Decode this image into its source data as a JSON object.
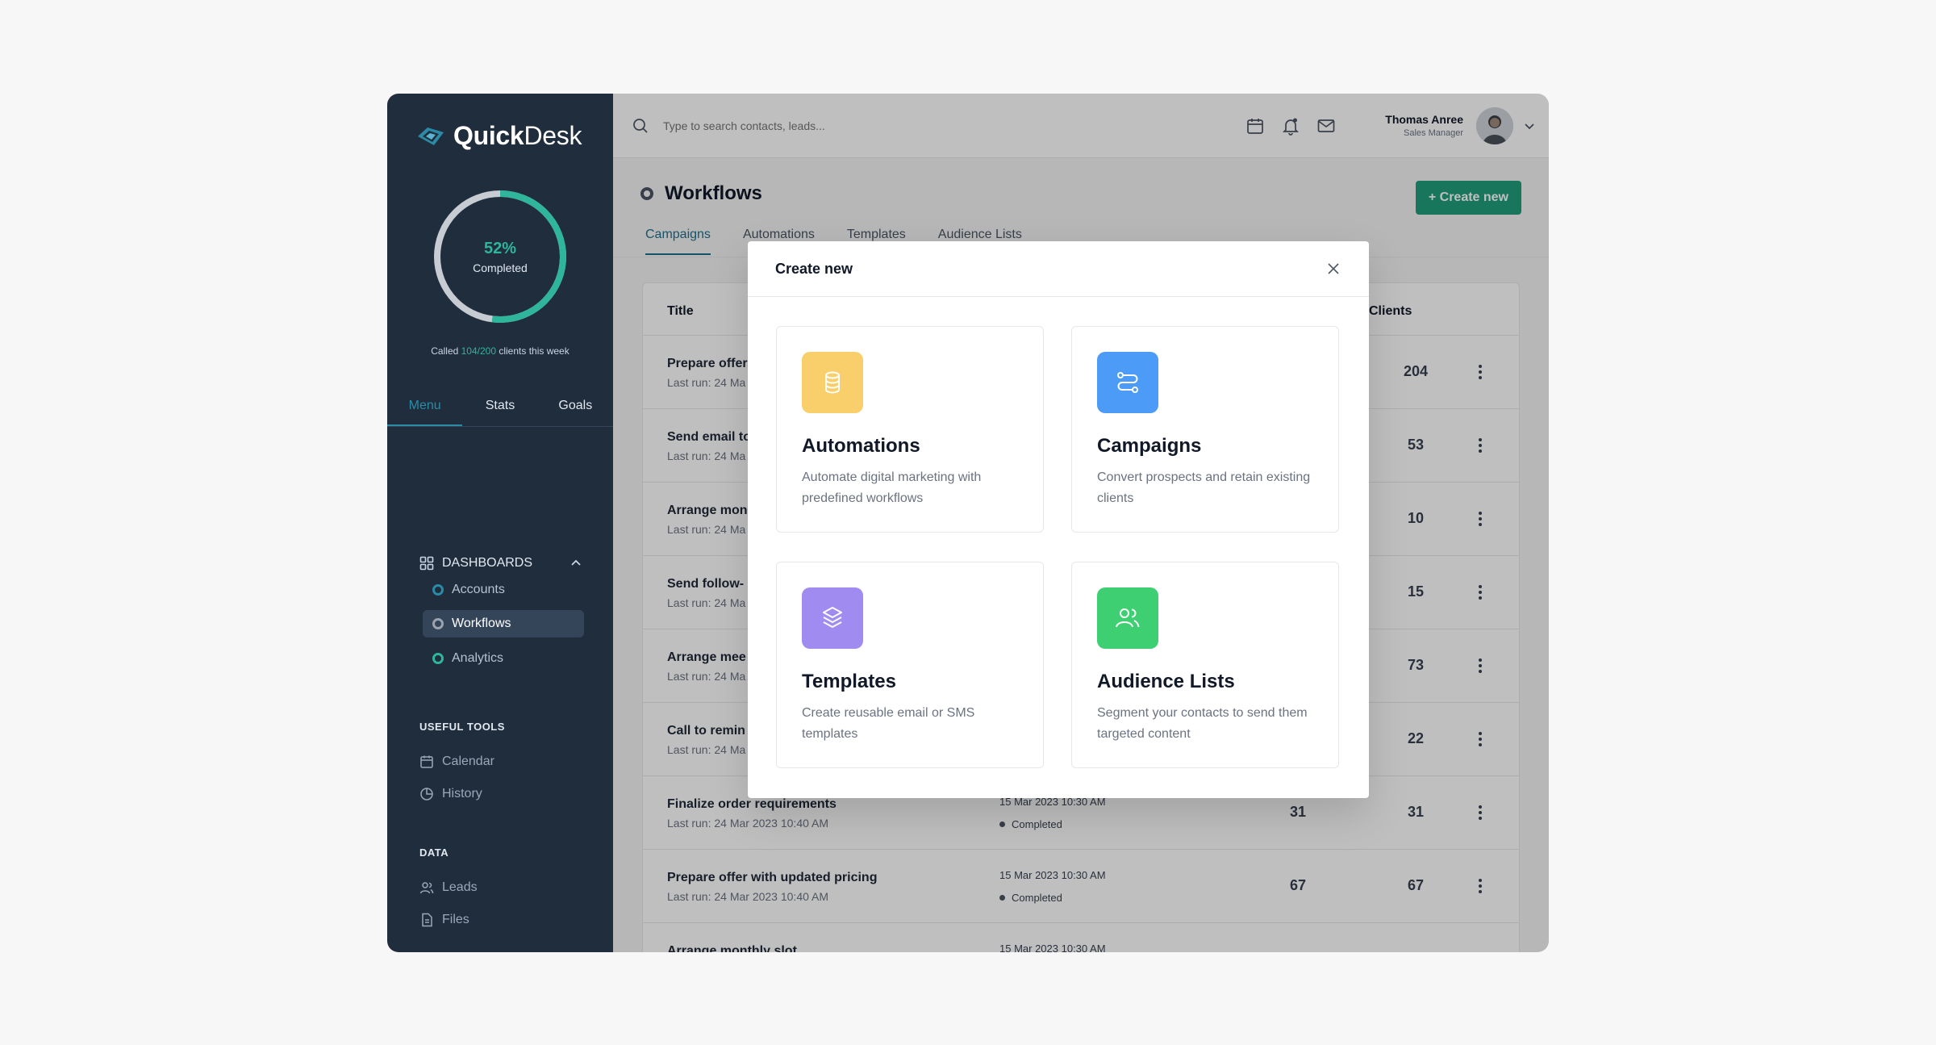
{
  "colors": {
    "accent": "#1f9e7a",
    "sidebar_bg": "#1f2d3d",
    "progress": "#2fb59a",
    "tab_active": "#1f6f8b"
  },
  "brand": {
    "name_bold": "Quick",
    "name_regular": "Desk"
  },
  "progress": {
    "value": 0.52,
    "percent_label": "52%",
    "label": "Completed",
    "called_prefix": "Called ",
    "called_value": "104/200",
    "called_suffix": " clients this week"
  },
  "sidebar": {
    "tabs": [
      {
        "label": "Menu"
      },
      {
        "label": "Stats"
      },
      {
        "label": "Goals"
      }
    ],
    "dashboards": {
      "label": "DASHBOARDS",
      "items": [
        {
          "label": "Accounts"
        },
        {
          "label": "Workflows"
        },
        {
          "label": "Analytics"
        }
      ]
    },
    "useful_tools": {
      "label": "USEFUL TOOLS",
      "items": [
        {
          "label": "Calendar",
          "icon": "calendar-icon"
        },
        {
          "label": "History",
          "icon": "history-icon"
        }
      ]
    },
    "data": {
      "label": "DATA",
      "items": [
        {
          "label": "Leads",
          "icon": "users-icon"
        },
        {
          "label": "Files",
          "icon": "file-icon"
        }
      ]
    }
  },
  "topbar": {
    "search_placeholder": "Type to search contacts, leads...",
    "user_name": "Thomas Anree",
    "user_role": "Sales Manager"
  },
  "page": {
    "title": "Workflows",
    "create_label": "+ Create new",
    "tabs": [
      {
        "label": "Campaigns"
      },
      {
        "label": "Automations"
      },
      {
        "label": "Templates"
      },
      {
        "label": "Audience Lists"
      }
    ]
  },
  "table": {
    "headers": {
      "title": "Title",
      "clients": "Clients"
    },
    "rows": [
      {
        "title": "Prepare offer",
        "sub": "Last run: 24 Ma",
        "date": "",
        "status": "",
        "n1": "",
        "n2": "204"
      },
      {
        "title": "Send email to",
        "sub": "Last run: 24 Ma",
        "date": "",
        "status": "",
        "n1": "",
        "n2": "53"
      },
      {
        "title": "Arrange mon",
        "sub": "Last run: 24 Ma",
        "date": "",
        "status": "",
        "n1": "",
        "n2": "10"
      },
      {
        "title": "Send follow-",
        "sub": "Last run: 24 Ma",
        "date": "",
        "status": "",
        "n1": "",
        "n2": "15"
      },
      {
        "title": "Arrange mee",
        "sub": "Last run: 24 Ma",
        "date": "",
        "status": "",
        "n1": "",
        "n2": "73"
      },
      {
        "title": "Call to remin",
        "sub": "Last run: 24 Ma",
        "date": "",
        "status": "",
        "n1": "",
        "n2": "22"
      },
      {
        "title": "Finalize order requirements",
        "sub": "Last run: 24 Mar 2023 10:40 AM",
        "date": "15 Mar 2023 10:30 AM",
        "status": "Completed",
        "n1": "31",
        "n2": "31"
      },
      {
        "title": "Prepare offer with updated pricing",
        "sub": "Last run: 24 Mar 2023 10:40 AM",
        "date": "15 Mar 2023 10:30 AM",
        "status": "Completed",
        "n1": "67",
        "n2": "67"
      },
      {
        "title": "Arrange monthly slot",
        "sub": "",
        "date": "15 Mar 2023 10:30 AM",
        "status": "",
        "n1": "",
        "n2": ""
      }
    ]
  },
  "modal": {
    "title": "Create new",
    "cards": [
      {
        "title": "Automations",
        "desc": "Automate digital marketing with predefined workflows",
        "icon": "database-icon",
        "color": "#f8cf6a"
      },
      {
        "title": "Campaigns",
        "desc": "Convert prospects and retain existing clients",
        "icon": "route-icon",
        "color": "#4c9cf7"
      },
      {
        "title": "Templates",
        "desc": "Create reusable email or SMS templates",
        "icon": "layers-icon",
        "color": "#a08cf1"
      },
      {
        "title": "Audience Lists",
        "desc": "Segment your contacts to send them targeted content",
        "icon": "users-icon",
        "color": "#3ecf72"
      }
    ]
  }
}
